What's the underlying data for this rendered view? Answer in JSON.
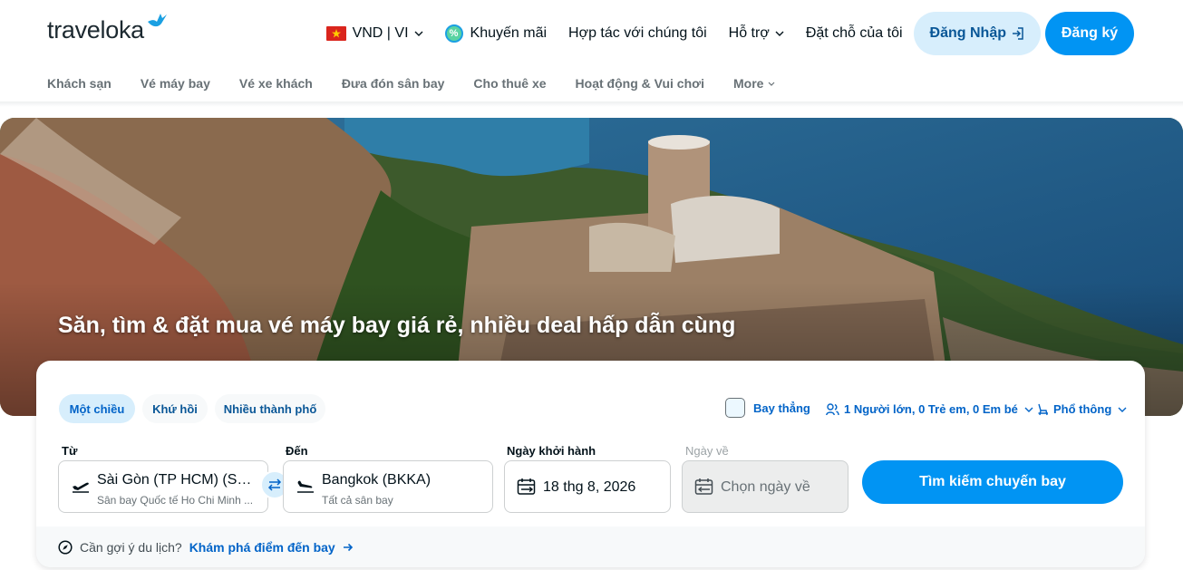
{
  "brand": {
    "logo_text": "traveloka"
  },
  "header": {
    "currency_lang": "VND | VI",
    "promo": "Khuyến mãi",
    "partner": "Hợp tác với chúng tôi",
    "support": "Hỗ trợ",
    "my_bookings": "Đặt chỗ của tôi",
    "login": "Đăng Nhập",
    "signup": "Đăng ký"
  },
  "subnav": {
    "items": [
      "Khách sạn",
      "Vé máy bay",
      "Vé xe khách",
      "Đưa đón sân bay",
      "Cho thuê xe",
      "Hoạt động & Vui chơi"
    ],
    "more": "More"
  },
  "hero": {
    "title": "Săn, tìm & đặt mua vé máy bay giá rẻ, nhiều deal hấp dẫn cùng"
  },
  "search": {
    "trip_types": [
      "Một chiều",
      "Khứ hồi",
      "Nhiều thành phố"
    ],
    "direct_flight": "Bay thẳng",
    "passengers": "1 Người lớn, 0 Trẻ em, 0 Em bé",
    "cabin": "Phổ thông",
    "from_label": "Từ",
    "from_city": "Sài Gòn (TP HCM) (SGN)",
    "from_airport": "Sân bay Quốc tế Ho Chi Minh ...",
    "to_label": "Đến",
    "to_city": "Bangkok (BKKA)",
    "to_airport": "Tất cả sân bay",
    "depart_label": "Ngày khởi hành",
    "depart_date": "18 thg 8, 2026",
    "return_label": "Ngày về",
    "return_placeholder": "Chọn ngày về",
    "search_button": "Tìm kiếm chuyến bay",
    "suggest_text": "Cần gợi ý du lịch?",
    "suggest_link": "Khám phá điểm đến bay"
  },
  "colors": {
    "primary": "#0194f3",
    "primary_light": "#d7eefc",
    "link": "#0264c8",
    "text": "#03121a",
    "muted": "#687176"
  }
}
